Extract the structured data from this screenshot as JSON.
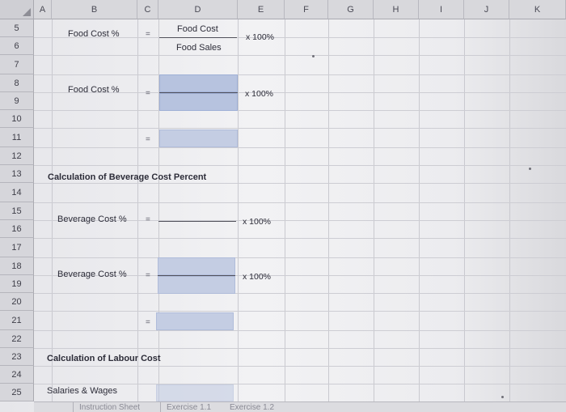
{
  "columns": [
    "A",
    "B",
    "C",
    "D",
    "E",
    "F",
    "G",
    "H",
    "I",
    "J",
    "K"
  ],
  "rows": [
    "5",
    "6",
    "7",
    "8",
    "9",
    "10",
    "11",
    "12",
    "13",
    "14",
    "15",
    "16",
    "17",
    "18",
    "19",
    "20",
    "21",
    "22",
    "23",
    "24",
    "25"
  ],
  "labels": {
    "food_cost_pct_1": "Food Cost %",
    "food_cost_num": "Food Cost",
    "food_sales_den": "Food Sales",
    "x100_1": "x 100%",
    "food_cost_pct_2": "Food Cost %",
    "x100_2": "x 100%",
    "section_beverage": "Calculation of Beverage Cost Percent",
    "beverage_cost_pct_1": "Beverage Cost %",
    "x100_3": "x 100%",
    "beverage_cost_pct_2": "Beverage Cost %",
    "x100_4": "x 100%",
    "section_labour": "Calculation of Labour Cost",
    "salaries_wages": "Salaries & Wages",
    "equals": "="
  },
  "sheet_tabs": [
    "Instruction Sheet",
    "Exercise 1.1",
    "Exercise 1.2"
  ],
  "colors": {
    "fill_blue": "#b7c3df",
    "header_gray": "#d8d8dc"
  }
}
